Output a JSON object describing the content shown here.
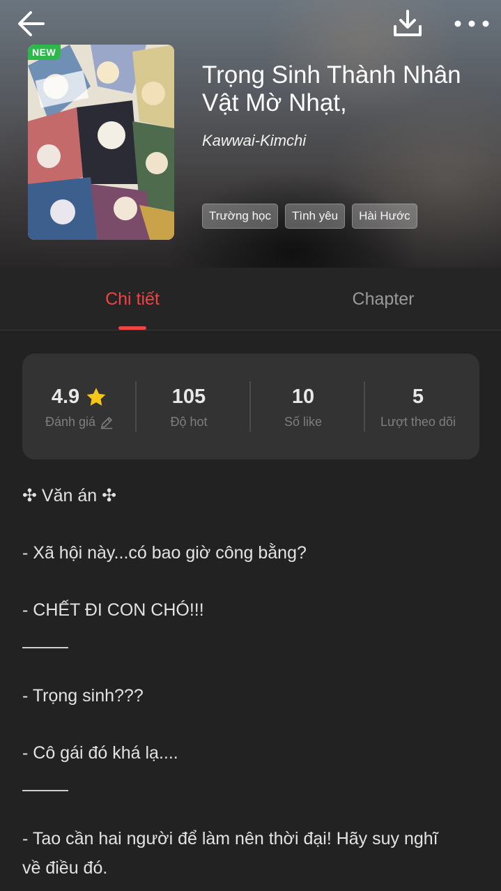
{
  "header": {
    "back_icon": "arrow-left-icon",
    "download_icon": "download-icon",
    "more_icon": "more-horizontal-icon"
  },
  "book": {
    "badge": "NEW",
    "title": "Trọng Sinh Thành Nhân Vật Mờ Nhạt,",
    "author": "Kawwai-Kimchi",
    "tags": [
      "Trường học",
      "Tình yêu",
      "Hài Hước"
    ]
  },
  "tabs": [
    {
      "label": "Chi tiết",
      "active": true
    },
    {
      "label": "Chapter",
      "active": false
    }
  ],
  "stats": [
    {
      "value": "4.9",
      "label": "Đánh giá",
      "icon": "star-icon",
      "label_icon": "pencil-icon"
    },
    {
      "value": "105",
      "label": "Độ hot"
    },
    {
      "value": "10",
      "label": "Số like"
    },
    {
      "value": "5",
      "label": "Lượt theo dõi"
    }
  ],
  "description": {
    "heading": "✣ Văn án ✣",
    "lines": [
      "- Xã hội này...có bao giờ công bằng?",
      "- CHẾT ĐI CON CHÓ!!!",
      "- Trọng sinh???",
      "- Cô gái đó khá lạ....",
      "- Tao cần hai người để làm nên thời đại! Hãy suy nghĩ",
      "về điều đó."
    ]
  },
  "colors": {
    "accent": "#ef4444",
    "badge_green": "#2db84b",
    "star": "#f5c518",
    "background": "#222222",
    "card": "#333333"
  }
}
